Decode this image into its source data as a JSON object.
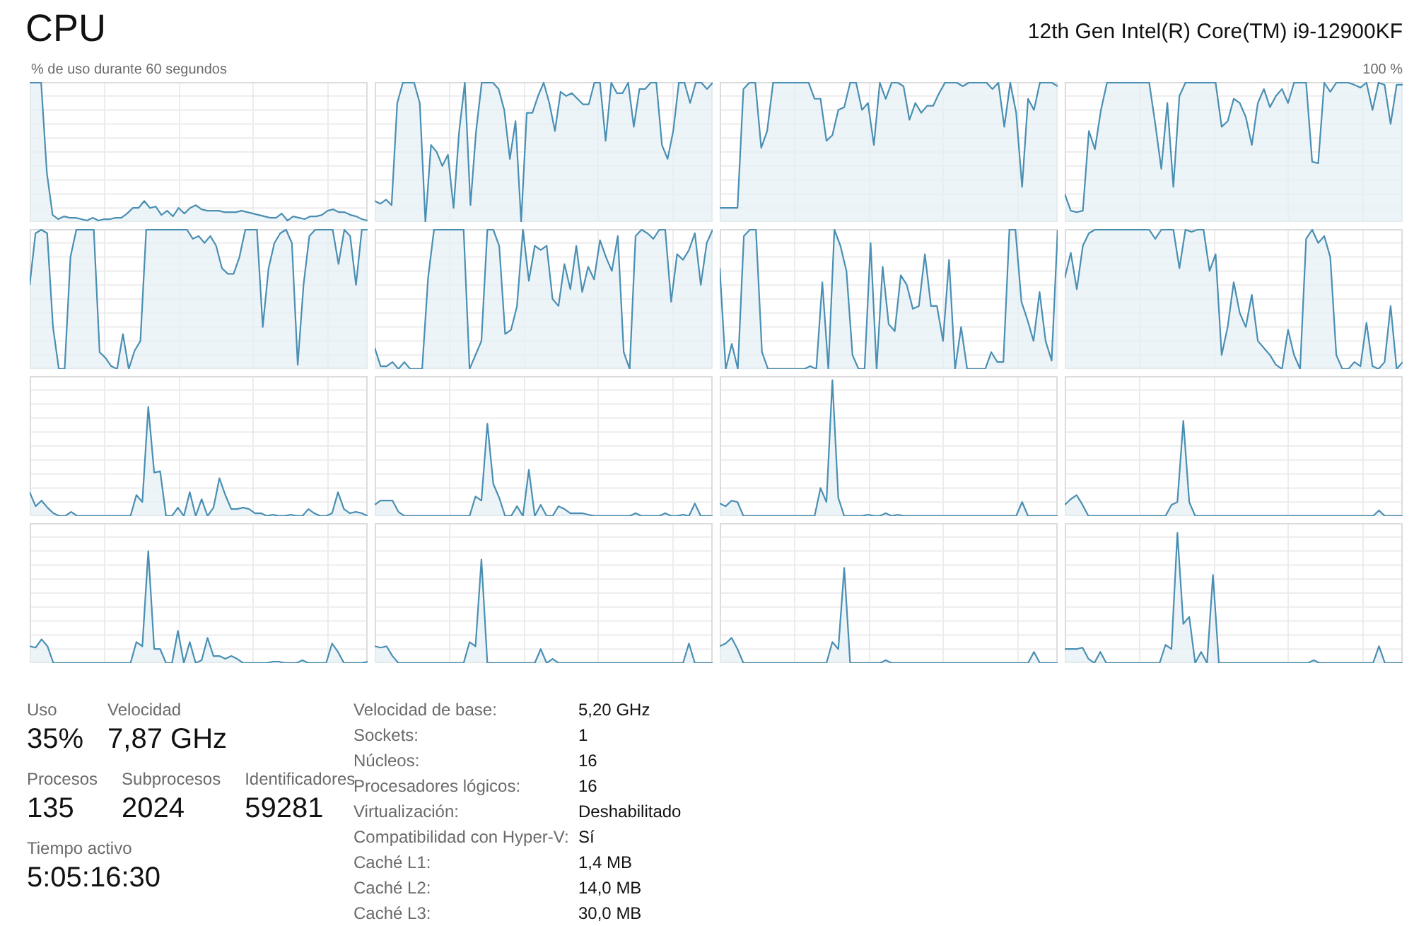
{
  "header": {
    "title": "CPU",
    "processor": "12th Gen Intel(R) Core(TM) i9-12900KF"
  },
  "graph": {
    "caption": "% de uso durante 60 segundos",
    "max_label": "100 %"
  },
  "stat_rows": [
    {
      "stats": [
        {
          "label": "Uso",
          "value": "35%"
        },
        {
          "label": "Velocidad",
          "value": "7,87 GHz"
        }
      ]
    },
    {
      "stats": [
        {
          "label": "Procesos",
          "value": "135"
        },
        {
          "label": "Subprocesos",
          "value": "2024"
        },
        {
          "label": "Identificadores",
          "value": "59281"
        }
      ]
    },
    {
      "stats": [
        {
          "label": "Tiempo activo",
          "value": "5:05:16:30"
        }
      ]
    }
  ],
  "specs": [
    {
      "label": "Velocidad de base:",
      "value": "5,20 GHz"
    },
    {
      "label": "Sockets:",
      "value": "1"
    },
    {
      "label": "Núcleos:",
      "value": "16"
    },
    {
      "label": "Procesadores lógicos:",
      "value": "16"
    },
    {
      "label": "Virtualización:",
      "value": "Deshabilitado"
    },
    {
      "label": "Compatibilidad con Hyper-V:",
      "value": "Sí"
    },
    {
      "label": "Caché L1:",
      "value": "1,4 MB"
    },
    {
      "label": "Caché L2:",
      "value": "14,0 MB"
    },
    {
      "label": "Caché L3:",
      "value": "30,0 MB"
    }
  ]
}
